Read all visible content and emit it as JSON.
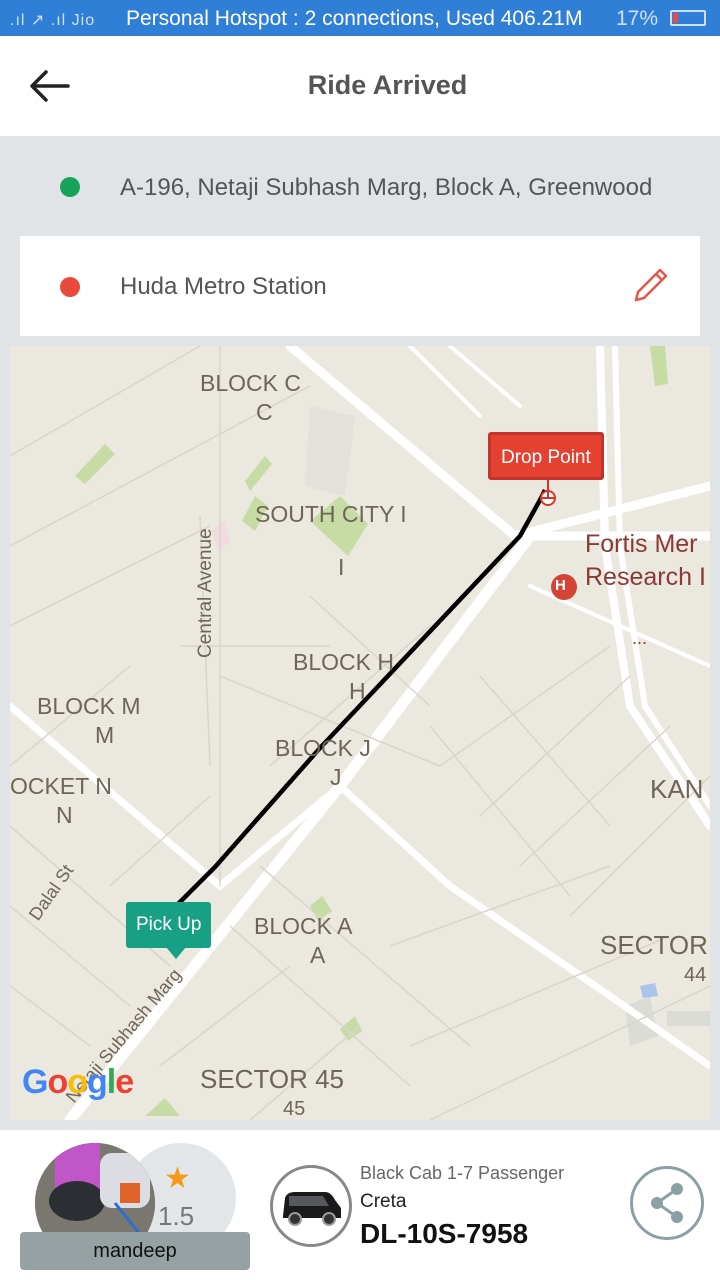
{
  "status_bar": {
    "signal_text": ".ıl ↗ .ıl Jio",
    "hotspot_text": "Personal Hotspot : 2 connections, Used 406.21M",
    "battery_percent": "17%"
  },
  "header": {
    "title": "Ride Arrived"
  },
  "pickup": {
    "address": "A-196, Netaji Subhash Marg, Block A, Greenwood",
    "dot_color": "#17a45a"
  },
  "drop": {
    "address": "Huda Metro Station",
    "dot_color": "#e84a3c"
  },
  "map": {
    "labels": {
      "block_c": "BLOCK C",
      "block_c_sub": "C",
      "south_city": "SOUTH CITY I",
      "south_city_sub": "I",
      "central_avenue": "Central Avenue",
      "block_h": "BLOCK H",
      "block_h_sub": "H",
      "block_m": "BLOCK M",
      "block_m_sub": "M",
      "block_j": "BLOCK J",
      "block_j_sub": "J",
      "pocket_n": "OCKET N",
      "pocket_n_sub": "N",
      "dalal_st": "Dalal St",
      "block_a": "BLOCK A",
      "block_a_sub": "A",
      "netaji_marg": "Netaji Subhash Marg",
      "fortis_1": "Fortis Mer",
      "fortis_2": "Research I",
      "fortis_3": "...",
      "kan": "KAN",
      "sector_right": "SECTOR",
      "sector_right_num": "44",
      "sector_45": "SECTOR 45",
      "sector_45_num": "45",
      "hospital_glyph": "H",
      "google": "Google"
    },
    "drop_marker": "Drop Point",
    "pickup_marker": "Pick Up",
    "drop_marker_color": "#e34233",
    "pickup_marker_color": "#17a084",
    "route_color": "#000000"
  },
  "driver": {
    "name": "mandeep",
    "rating": "1.5",
    "star_icon": "star-icon",
    "star_color": "#f59a1b"
  },
  "car": {
    "type": "Black Cab 1-7 Passenger",
    "model": "Creta",
    "plate": "DL-10S-7958"
  }
}
